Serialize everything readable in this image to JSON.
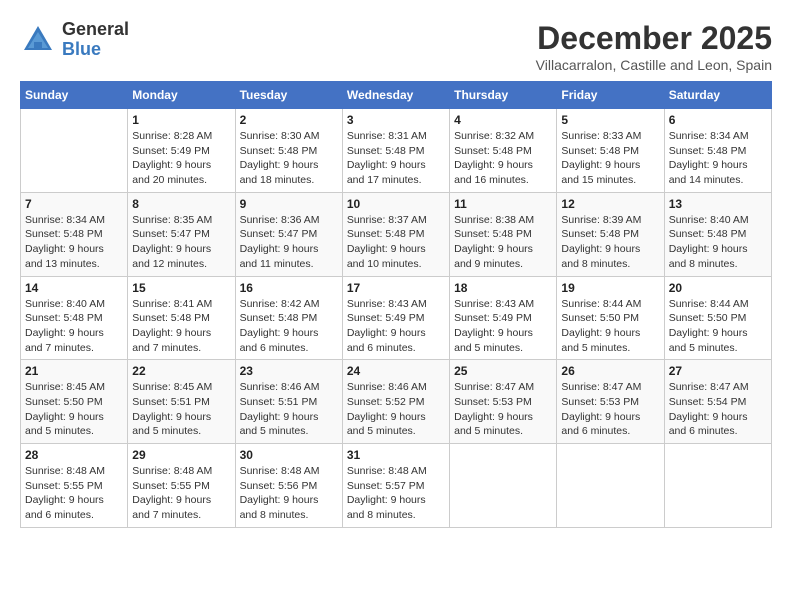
{
  "header": {
    "logo_general": "General",
    "logo_blue": "Blue",
    "month_title": "December 2025",
    "location": "Villacarralon, Castille and Leon, Spain"
  },
  "days_of_week": [
    "Sunday",
    "Monday",
    "Tuesday",
    "Wednesday",
    "Thursday",
    "Friday",
    "Saturday"
  ],
  "weeks": [
    [
      {
        "day": "",
        "sunrise": "",
        "sunset": "",
        "daylight": ""
      },
      {
        "day": "1",
        "sunrise": "Sunrise: 8:28 AM",
        "sunset": "Sunset: 5:49 PM",
        "daylight": "Daylight: 9 hours and 20 minutes."
      },
      {
        "day": "2",
        "sunrise": "Sunrise: 8:30 AM",
        "sunset": "Sunset: 5:48 PM",
        "daylight": "Daylight: 9 hours and 18 minutes."
      },
      {
        "day": "3",
        "sunrise": "Sunrise: 8:31 AM",
        "sunset": "Sunset: 5:48 PM",
        "daylight": "Daylight: 9 hours and 17 minutes."
      },
      {
        "day": "4",
        "sunrise": "Sunrise: 8:32 AM",
        "sunset": "Sunset: 5:48 PM",
        "daylight": "Daylight: 9 hours and 16 minutes."
      },
      {
        "day": "5",
        "sunrise": "Sunrise: 8:33 AM",
        "sunset": "Sunset: 5:48 PM",
        "daylight": "Daylight: 9 hours and 15 minutes."
      },
      {
        "day": "6",
        "sunrise": "Sunrise: 8:34 AM",
        "sunset": "Sunset: 5:48 PM",
        "daylight": "Daylight: 9 hours and 14 minutes."
      }
    ],
    [
      {
        "day": "7",
        "sunrise": "Sunrise: 8:34 AM",
        "sunset": "Sunset: 5:48 PM",
        "daylight": "Daylight: 9 hours and 13 minutes."
      },
      {
        "day": "8",
        "sunrise": "Sunrise: 8:35 AM",
        "sunset": "Sunset: 5:47 PM",
        "daylight": "Daylight: 9 hours and 12 minutes."
      },
      {
        "day": "9",
        "sunrise": "Sunrise: 8:36 AM",
        "sunset": "Sunset: 5:47 PM",
        "daylight": "Daylight: 9 hours and 11 minutes."
      },
      {
        "day": "10",
        "sunrise": "Sunrise: 8:37 AM",
        "sunset": "Sunset: 5:48 PM",
        "daylight": "Daylight: 9 hours and 10 minutes."
      },
      {
        "day": "11",
        "sunrise": "Sunrise: 8:38 AM",
        "sunset": "Sunset: 5:48 PM",
        "daylight": "Daylight: 9 hours and 9 minutes."
      },
      {
        "day": "12",
        "sunrise": "Sunrise: 8:39 AM",
        "sunset": "Sunset: 5:48 PM",
        "daylight": "Daylight: 9 hours and 8 minutes."
      },
      {
        "day": "13",
        "sunrise": "Sunrise: 8:40 AM",
        "sunset": "Sunset: 5:48 PM",
        "daylight": "Daylight: 9 hours and 8 minutes."
      }
    ],
    [
      {
        "day": "14",
        "sunrise": "Sunrise: 8:40 AM",
        "sunset": "Sunset: 5:48 PM",
        "daylight": "Daylight: 9 hours and 7 minutes."
      },
      {
        "day": "15",
        "sunrise": "Sunrise: 8:41 AM",
        "sunset": "Sunset: 5:48 PM",
        "daylight": "Daylight: 9 hours and 7 minutes."
      },
      {
        "day": "16",
        "sunrise": "Sunrise: 8:42 AM",
        "sunset": "Sunset: 5:48 PM",
        "daylight": "Daylight: 9 hours and 6 minutes."
      },
      {
        "day": "17",
        "sunrise": "Sunrise: 8:43 AM",
        "sunset": "Sunset: 5:49 PM",
        "daylight": "Daylight: 9 hours and 6 minutes."
      },
      {
        "day": "18",
        "sunrise": "Sunrise: 8:43 AM",
        "sunset": "Sunset: 5:49 PM",
        "daylight": "Daylight: 9 hours and 5 minutes."
      },
      {
        "day": "19",
        "sunrise": "Sunrise: 8:44 AM",
        "sunset": "Sunset: 5:50 PM",
        "daylight": "Daylight: 9 hours and 5 minutes."
      },
      {
        "day": "20",
        "sunrise": "Sunrise: 8:44 AM",
        "sunset": "Sunset: 5:50 PM",
        "daylight": "Daylight: 9 hours and 5 minutes."
      }
    ],
    [
      {
        "day": "21",
        "sunrise": "Sunrise: 8:45 AM",
        "sunset": "Sunset: 5:50 PM",
        "daylight": "Daylight: 9 hours and 5 minutes."
      },
      {
        "day": "22",
        "sunrise": "Sunrise: 8:45 AM",
        "sunset": "Sunset: 5:51 PM",
        "daylight": "Daylight: 9 hours and 5 minutes."
      },
      {
        "day": "23",
        "sunrise": "Sunrise: 8:46 AM",
        "sunset": "Sunset: 5:51 PM",
        "daylight": "Daylight: 9 hours and 5 minutes."
      },
      {
        "day": "24",
        "sunrise": "Sunrise: 8:46 AM",
        "sunset": "Sunset: 5:52 PM",
        "daylight": "Daylight: 9 hours and 5 minutes."
      },
      {
        "day": "25",
        "sunrise": "Sunrise: 8:47 AM",
        "sunset": "Sunset: 5:53 PM",
        "daylight": "Daylight: 9 hours and 5 minutes."
      },
      {
        "day": "26",
        "sunrise": "Sunrise: 8:47 AM",
        "sunset": "Sunset: 5:53 PM",
        "daylight": "Daylight: 9 hours and 6 minutes."
      },
      {
        "day": "27",
        "sunrise": "Sunrise: 8:47 AM",
        "sunset": "Sunset: 5:54 PM",
        "daylight": "Daylight: 9 hours and 6 minutes."
      }
    ],
    [
      {
        "day": "28",
        "sunrise": "Sunrise: 8:48 AM",
        "sunset": "Sunset: 5:55 PM",
        "daylight": "Daylight: 9 hours and 6 minutes."
      },
      {
        "day": "29",
        "sunrise": "Sunrise: 8:48 AM",
        "sunset": "Sunset: 5:55 PM",
        "daylight": "Daylight: 9 hours and 7 minutes."
      },
      {
        "day": "30",
        "sunrise": "Sunrise: 8:48 AM",
        "sunset": "Sunset: 5:56 PM",
        "daylight": "Daylight: 9 hours and 8 minutes."
      },
      {
        "day": "31",
        "sunrise": "Sunrise: 8:48 AM",
        "sunset": "Sunset: 5:57 PM",
        "daylight": "Daylight: 9 hours and 8 minutes."
      },
      {
        "day": "",
        "sunrise": "",
        "sunset": "",
        "daylight": ""
      },
      {
        "day": "",
        "sunrise": "",
        "sunset": "",
        "daylight": ""
      },
      {
        "day": "",
        "sunrise": "",
        "sunset": "",
        "daylight": ""
      }
    ]
  ]
}
